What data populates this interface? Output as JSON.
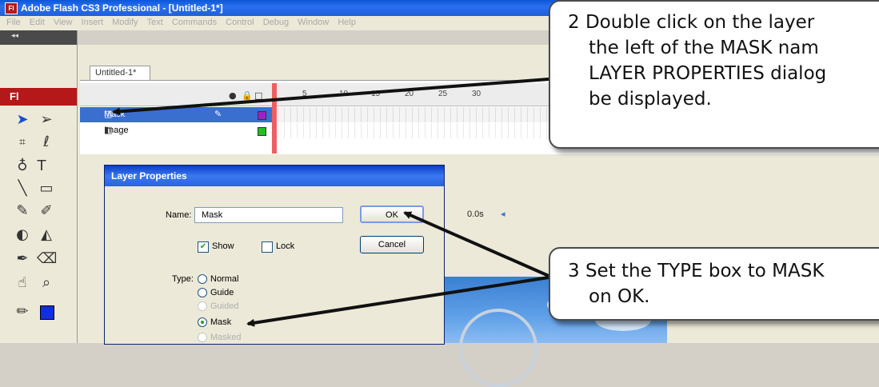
{
  "app": {
    "title": "Adobe Flash CS3 Professional - [Untitled-1*]",
    "title_icon": "Fl",
    "menu": [
      "File",
      "Edit",
      "View",
      "Insert",
      "Modify",
      "Text",
      "Commands",
      "Control",
      "Debug",
      "Window",
      "Help"
    ],
    "tools_badge": "Fl",
    "tools_grip": "◂◂"
  },
  "document_tab": "Untitled-1*",
  "timeline": {
    "frame_numbers": [
      "5",
      "10",
      "15",
      "20",
      "25",
      "30"
    ],
    "header_icons": [
      "eye-icon",
      "lock-icon",
      "outline-icon"
    ],
    "layers": [
      {
        "name": "Mask",
        "selected": true,
        "color": "#a020c8"
      },
      {
        "name": "Image",
        "selected": false,
        "color": "#20c020"
      }
    ],
    "fps_text": "0.0s"
  },
  "dialog": {
    "title": "Layer Properties",
    "name_label": "Name:",
    "name_value": "Mask",
    "show_label": "Show",
    "lock_label": "Lock",
    "ok_label": "OK",
    "cancel_label": "Cancel",
    "type_label": "Type:",
    "types": [
      {
        "label": "Normal",
        "checked": false,
        "disabled": false
      },
      {
        "label": "Guide",
        "checked": false,
        "disabled": false
      },
      {
        "label": "Guided",
        "checked": false,
        "disabled": true
      },
      {
        "label": "Mask",
        "checked": true,
        "disabled": false
      },
      {
        "label": "Masked",
        "checked": false,
        "disabled": true
      }
    ]
  },
  "callouts": {
    "step2": [
      "2  Double click on the layer",
      "the left of the MASK nam",
      "LAYER PROPERTIES dialog",
      "be displayed."
    ],
    "step3": [
      "3  Set the TYPE box to MASK",
      "on OK."
    ]
  },
  "colors": {
    "title_blue": "#0a58d8",
    "flash_red": "#b41818",
    "selected_layer": "#3a6fd0"
  }
}
